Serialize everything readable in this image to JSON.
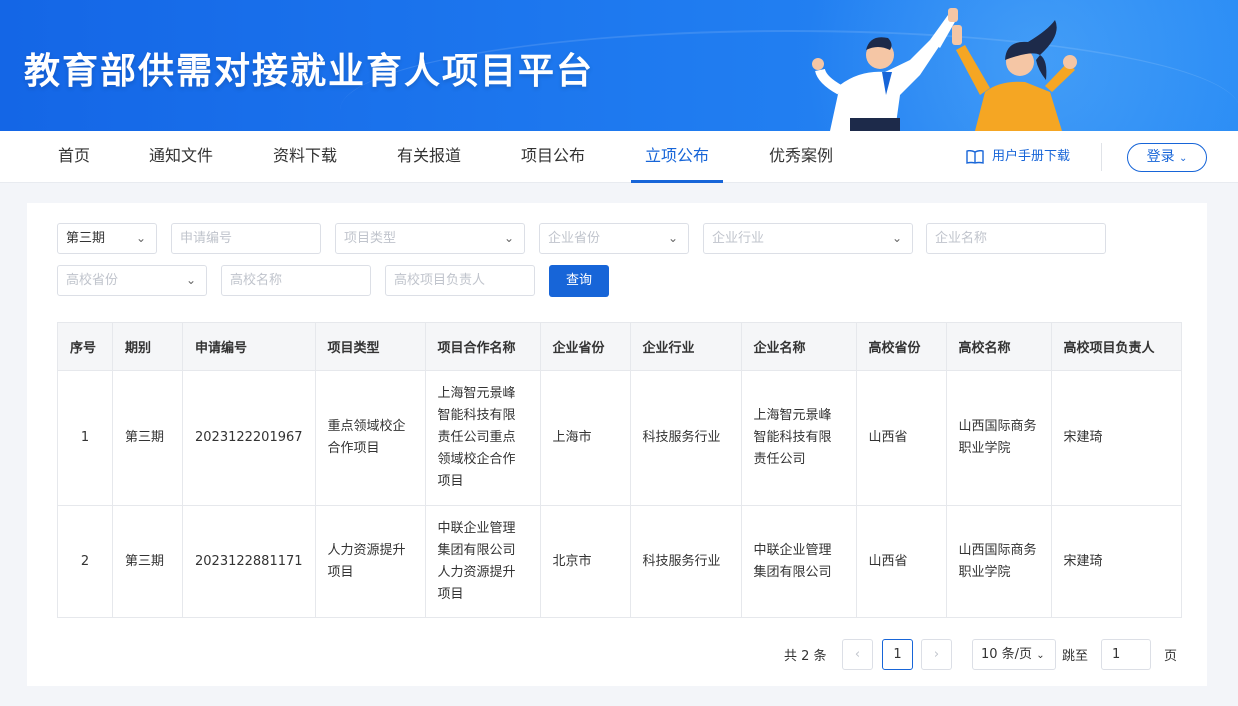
{
  "site": {
    "title": "教育部供需对接就业育人项目平台"
  },
  "nav": {
    "items": [
      {
        "label": "首页"
      },
      {
        "label": "通知文件"
      },
      {
        "label": "资料下载"
      },
      {
        "label": "有关报道"
      },
      {
        "label": "项目公布"
      },
      {
        "label": "立项公布"
      },
      {
        "label": "优秀案例"
      }
    ],
    "active_index": 5,
    "manual_label": "用户手册下载",
    "login_label": "登录"
  },
  "filters": {
    "period_value": "第三期",
    "application_no_placeholder": "申请编号",
    "project_type_placeholder": "项目类型",
    "company_province_placeholder": "企业省份",
    "company_industry_placeholder": "企业行业",
    "company_name_placeholder": "企业名称",
    "university_province_placeholder": "高校省份",
    "university_name_placeholder": "高校名称",
    "project_leader_placeholder": "高校项目负责人",
    "query_label": "查询"
  },
  "table": {
    "headers": [
      "序号",
      "期别",
      "申请编号",
      "项目类型",
      "项目合作名称",
      "企业省份",
      "企业行业",
      "企业名称",
      "高校省份",
      "高校名称",
      "高校项目负责人"
    ],
    "rows": [
      [
        "1",
        "第三期",
        "2023122201967",
        "重点领域校企合作项目",
        "上海智元景峰智能科技有限责任公司重点领域校企合作项目",
        "上海市",
        "科技服务行业",
        "上海智元景峰智能科技有限责任公司",
        "山西省",
        "山西国际商务职业学院",
        "宋建琦"
      ],
      [
        "2",
        "第三期",
        "2023122881171",
        "人力资源提升项目",
        "中联企业管理集团有限公司人力资源提升项目",
        "北京市",
        "科技服务行业",
        "中联企业管理集团有限公司",
        "山西省",
        "山西国际商务职业学院",
        "宋建琦"
      ]
    ]
  },
  "pager": {
    "total_text": "共 2 条",
    "prev": "‹",
    "next": "›",
    "current_page": "1",
    "page_size": "10 条/页",
    "jump_label": "跳至",
    "jump_value": "1",
    "page_suffix": "页"
  }
}
